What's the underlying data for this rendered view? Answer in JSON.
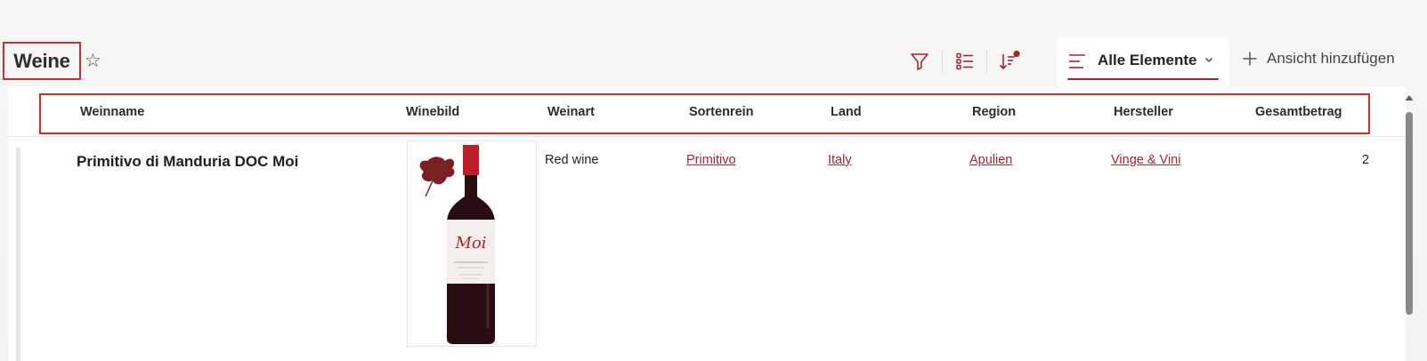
{
  "page": {
    "title": "Weine"
  },
  "toolbar": {
    "icons": [
      "filter-icon",
      "list-settings-icon",
      "sort-icon"
    ],
    "view": {
      "label": "Alle Elemente"
    },
    "add_view_label": "Ansicht hinzufügen"
  },
  "table": {
    "headers": [
      "Weinname",
      "Winebild",
      "Weinart",
      "Sortenrein",
      "Land",
      "Region",
      "Hersteller",
      "Gesamtbetrag"
    ],
    "rows": [
      {
        "name": "Primitivo di Manduria DOC Moi",
        "image_label": "Moi",
        "type": "Red wine",
        "variety": "Primitivo",
        "country": "Italy",
        "region": "Apulien",
        "producer": "Vinge & Vini",
        "total": "2"
      }
    ]
  },
  "colors": {
    "accent": "#a4262c",
    "highlight_border": "#d42a2a",
    "background": "#f8f7f6"
  }
}
